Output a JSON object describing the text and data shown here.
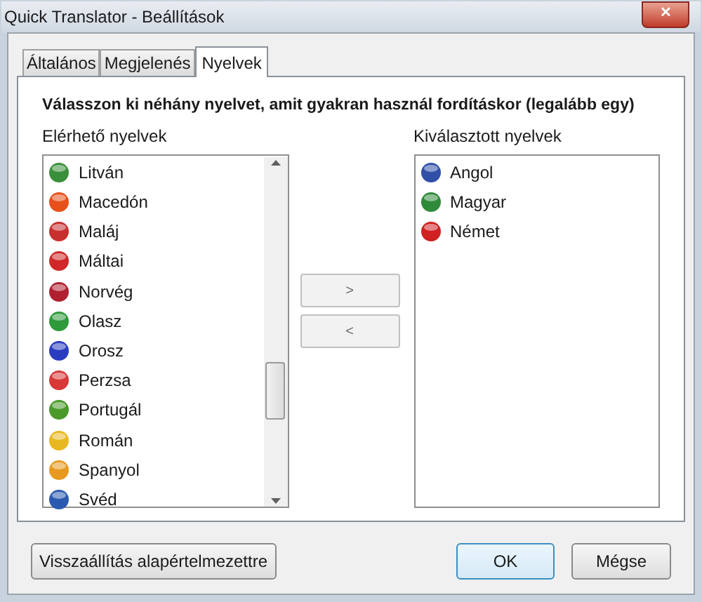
{
  "window": {
    "title": "Quick Translator - Beállítások",
    "close": "✕"
  },
  "tabs": [
    {
      "label": "Általános",
      "selected": false
    },
    {
      "label": "Megjelenés",
      "selected": false
    },
    {
      "label": "Nyelvek",
      "selected": true
    }
  ],
  "heading": "Válasszon ki néhány nyelvet, amit gyakran használ fordításkor (legalább egy)",
  "available": {
    "label": "Elérhető nyelvek",
    "items": [
      {
        "name": "Litván",
        "color": "#3a8f3a"
      },
      {
        "name": "Macedón",
        "color": "#e8501a"
      },
      {
        "name": "Maláj",
        "color": "#c83030"
      },
      {
        "name": "Máltai",
        "color": "#d02828"
      },
      {
        "name": "Norvég",
        "color": "#b02030"
      },
      {
        "name": "Olasz",
        "color": "#2e9a3a"
      },
      {
        "name": "Orosz",
        "color": "#2a3cc0"
      },
      {
        "name": "Perzsa",
        "color": "#d83838"
      },
      {
        "name": "Portugál",
        "color": "#4a9a2a"
      },
      {
        "name": "Román",
        "color": "#e8b820"
      },
      {
        "name": "Spanyol",
        "color": "#e89a20"
      },
      {
        "name": "Svéd",
        "color": "#2a5ab0"
      }
    ]
  },
  "move_buttons": [
    ">",
    "<"
  ],
  "chosen": {
    "label": "Kiválasztott nyelvek",
    "items": [
      {
        "name": "Angol",
        "color": "#3050a8"
      },
      {
        "name": "Magyar",
        "color": "#2f8a3a"
      },
      {
        "name": "Német",
        "color": "#d02020"
      }
    ]
  },
  "buttons": {
    "reset": "Visszaállítás alapértelmezettre",
    "ok": "OK",
    "cancel": "Mégse"
  }
}
